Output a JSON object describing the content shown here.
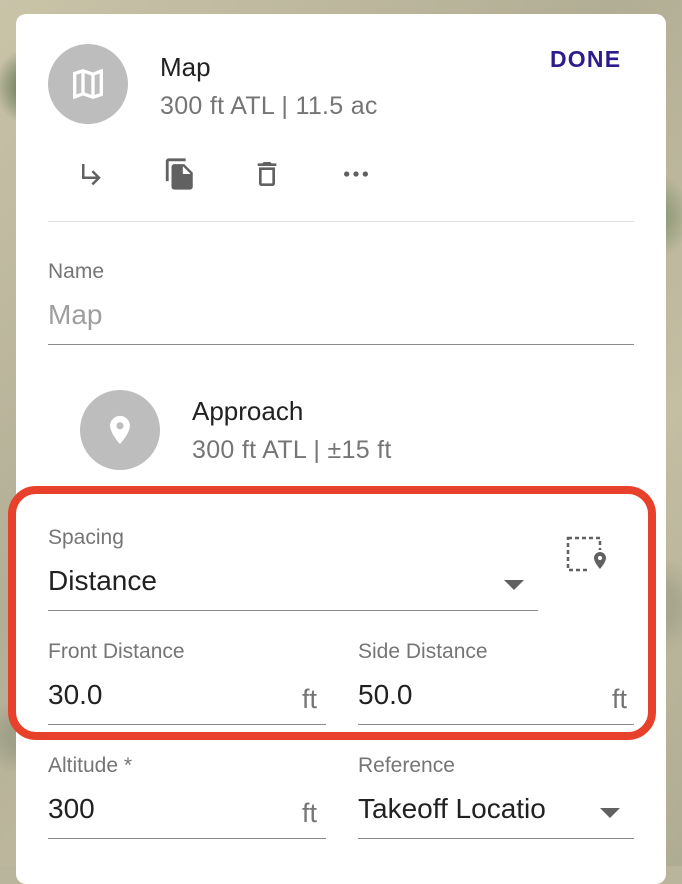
{
  "header": {
    "title": "Map",
    "subtitle": "300 ft ATL | 11.5 ac",
    "done_label": "DONE",
    "avatar_icon": "map-icon"
  },
  "toolbar": {
    "icons": [
      "subdirectory-arrow-icon",
      "copy-icon",
      "delete-icon",
      "more-icon"
    ]
  },
  "name_field": {
    "label": "Name",
    "placeholder": "Map"
  },
  "approach": {
    "title": "Approach",
    "subtitle": "300 ft ATL | ±15 ft",
    "icon": "location-pin-icon"
  },
  "spacing": {
    "label": "Spacing",
    "value": "Distance",
    "side_icon": "area-pin-icon"
  },
  "front_distance": {
    "label": "Front Distance",
    "value": "30.0",
    "unit": "ft"
  },
  "side_distance": {
    "label": "Side Distance",
    "value": "50.0",
    "unit": "ft"
  },
  "altitude": {
    "label": "Altitude *",
    "value": "300",
    "unit": "ft"
  },
  "reference": {
    "label": "Reference",
    "value": "Takeoff Locatio"
  },
  "colors": {
    "accent": "#2e1c8c",
    "highlight": "#e8412b",
    "avatar": "#bdbdbd"
  }
}
